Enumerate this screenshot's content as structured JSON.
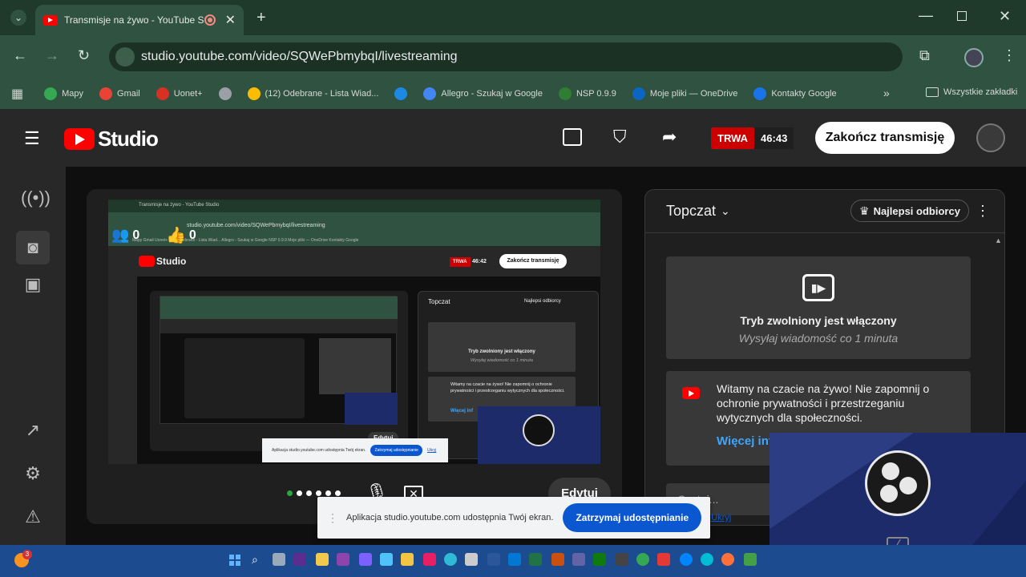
{
  "browser": {
    "tab_title": "Transmisje na żywo - YouTube Studio",
    "url": "studio.youtube.com/video/SQWePbmybqI/livestreaming",
    "bookmarks": [
      {
        "label": "Mapy",
        "color": "#34a853"
      },
      {
        "label": "Gmail",
        "color": "#ea4335"
      },
      {
        "label": "Uonet+",
        "color": "#d93025"
      },
      {
        "label": "",
        "color": "#9aa0a6"
      },
      {
        "label": "(12) Odebrane - Lista Wiad...",
        "color": "#fbbc04"
      },
      {
        "label": "",
        "color": "#1e88e5"
      },
      {
        "label": "Allegro - Szukaj w Google",
        "color": "#4285f4"
      },
      {
        "label": "NSP 0.9.9",
        "color": "#2e7d32"
      },
      {
        "label": "Moje pliki — OneDrive",
        "color": "#0a66c2"
      },
      {
        "label": "Kontakty Google",
        "color": "#1a73e8"
      }
    ],
    "all_bookmarks": "Wszystkie zakładki"
  },
  "studio": {
    "logo_text": "Studio",
    "live_badge": "TRWA",
    "timer": "46:43",
    "end_button": "Zakończ transmisję"
  },
  "preview": {
    "viewers": "0",
    "likes": "0",
    "edit_button": "Edytuj",
    "inner_bookmark_labels": "Mapy  Gmail  Uonet+  (12) Odebrane - Lista Wiad...  Allegro - Szukaj w Google  NSP 0.9.9  Moje pliki — OneDrive  Kontakty Google",
    "inner_url": "studio.youtube.com/video/SQWePbmybqI/livestreaming",
    "inner_tab_title": "Transmisje na żywo - YouTube Studio",
    "inner_live_badge": "TRWA",
    "inner_timer": "46:42",
    "inner_end_button": "Zakończ transmisję",
    "inner_chat_title": "Topczat",
    "inner_top_fans": "Najlepsi odbiorcy",
    "inner_slow_title": "Tryb zwolniony jest włączony",
    "inner_slow_sub": "Wysyłaj wiadomość co 1 minuta",
    "inner_welcome": "Witamy na czacie na żywo! Nie zapomnij o ochronie prywatności i przestrzeganiu wytycznych dla społeczności.",
    "inner_more": "Więcej inf",
    "inner_share_text": "Aplikacja studio.youtube.com udostępnia Twój ekran.",
    "inner_share_stop": "Zatrzymaj udostępnianie",
    "inner_share_hide": "Ukryj",
    "inner_edit": "Edytuj"
  },
  "chat": {
    "title": "Topczat",
    "top_fans": "Najlepsi odbiorcy",
    "slow_mode_title": "Tryb zwolniony jest włączony",
    "slow_mode_sub": "Wysyłaj wiadomość co 1 minuta",
    "welcome": "Witamy na czacie na żywo! Nie zapomnij o ochronie prywatności i przestrzeganiu wytycznych dla społeczności.",
    "more_link": "Więcej inf",
    "input_placeholder": "Czatuj..."
  },
  "share_bar": {
    "text": "Aplikacja studio.youtube.com udostępnia Twój ekran.",
    "stop_button": "Zatrzymaj udostępnianie",
    "hide_link": "Ukryj"
  },
  "taskbar": {
    "notification_count": "3"
  },
  "colors": {
    "yt_red": "#ff0000",
    "live_red": "#cc0000",
    "link_blue": "#3ea6ff",
    "taskbar_blue": "#1c4b8f"
  }
}
